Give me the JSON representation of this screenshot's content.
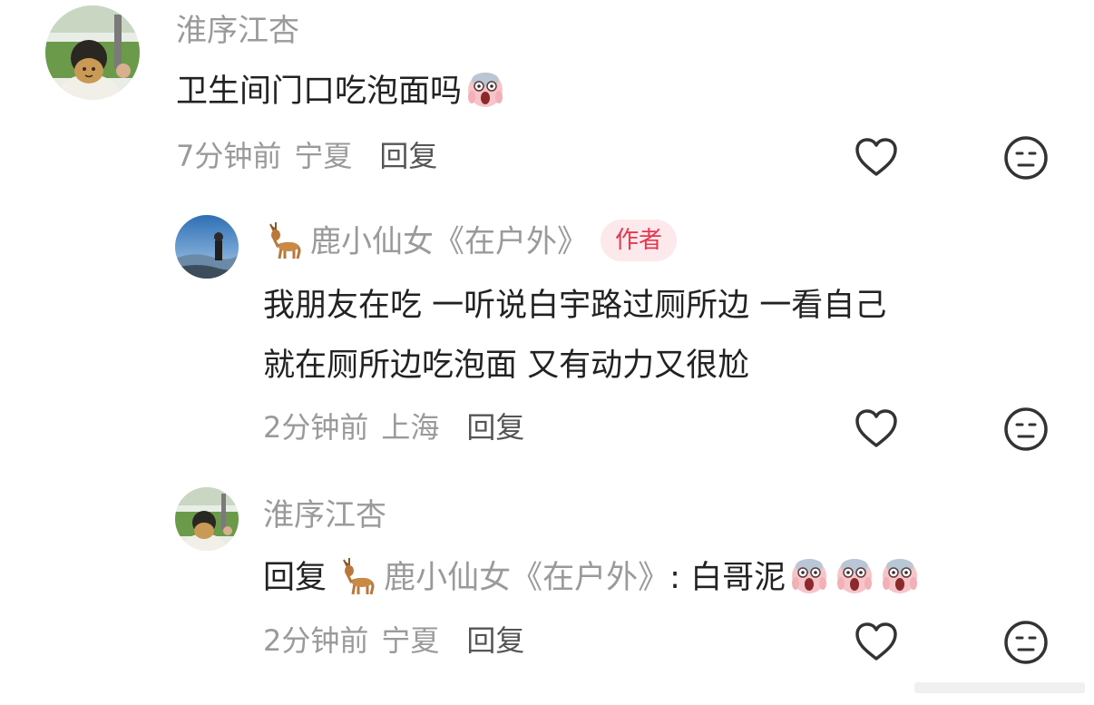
{
  "comments": [
    {
      "username": "淮序江杏",
      "text": "卫生间门口吃泡面吗",
      "time": "7分钟前",
      "location": "宁夏",
      "reply_label": "回复"
    },
    {
      "username": "鹿小仙女《在户外》",
      "badge": "作者",
      "text_line1": "我朋友在吃  一听说白宇路过厕所边  一看自己",
      "text_line2": "就在厕所边吃泡面  又有动力又很尬",
      "time": "2分钟前",
      "location": "上海",
      "reply_label": "回复"
    },
    {
      "username": "淮序江杏",
      "reply_prefix": "回复",
      "mention": "鹿小仙女《在户外》",
      "mention_suffix": ":",
      "text": "白哥泥",
      "time": "2分钟前",
      "location": "宁夏",
      "reply_label": "回复"
    }
  ],
  "icons": {
    "like": "heart-outline-icon",
    "dislike": "neutral-face-icon",
    "emoji": "scream-face-emoji",
    "deer": "deer-emoji"
  },
  "colors": {
    "username": "#9a9a9a",
    "text": "#222222",
    "badge_bg": "#fde8ec",
    "badge_text": "#e8364f"
  }
}
